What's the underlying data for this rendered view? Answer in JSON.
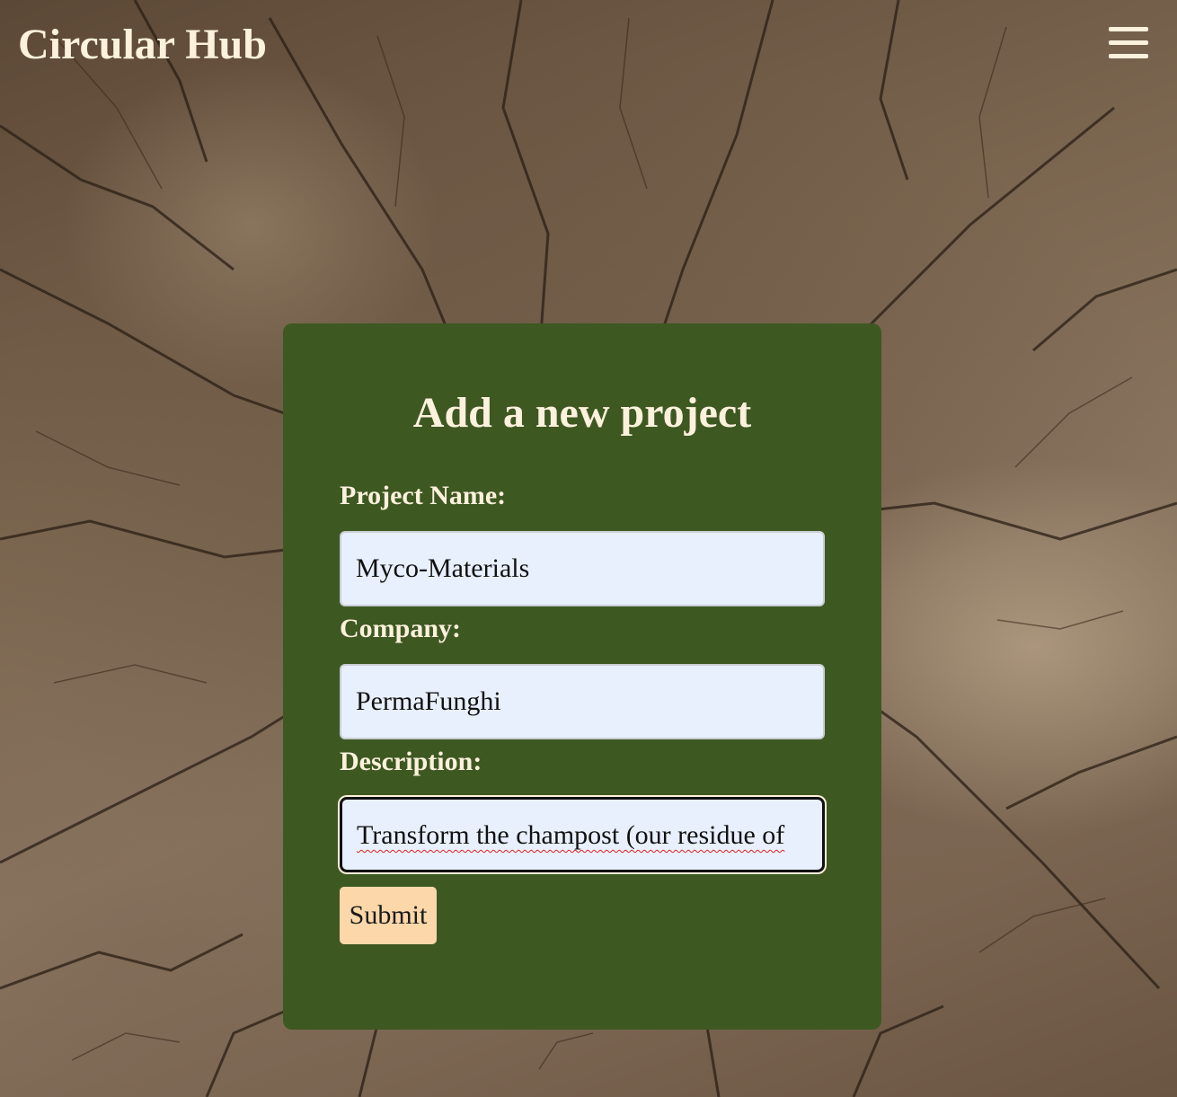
{
  "header": {
    "brand": "Circular Hub",
    "menu_icon": "hamburger-menu-icon"
  },
  "form": {
    "title": "Add a new project",
    "fields": [
      {
        "label": "Project Name:",
        "value": "Myco-Materials"
      },
      {
        "label": "Company:",
        "value": "PermaFunghi"
      },
      {
        "label": "Description:",
        "value": "Transform the champost (our residue of"
      }
    ],
    "submit_label": "Submit"
  },
  "colors": {
    "card_background": "#3e5822",
    "text_cream": "#fbf1dc",
    "input_background": "#e8f0fd",
    "submit_background": "#fbd7a9"
  }
}
